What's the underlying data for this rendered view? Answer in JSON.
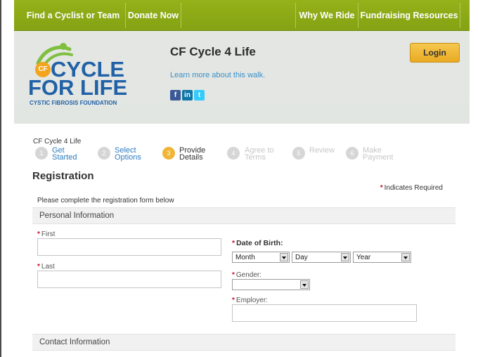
{
  "nav": {
    "left_items": [
      "Find a Cyclist or Team",
      "Donate Now"
    ],
    "right_items": [
      "Why We Ride",
      "Fundraising Resources"
    ]
  },
  "header": {
    "logo": {
      "badge": "CF",
      "line1": "CYCLE",
      "line2": "FOR LIFE",
      "sub": "CYSTIC FIBROSIS FOUNDATION"
    },
    "event_title": "CF Cycle 4 Life",
    "learn_more": "Learn more about this walk.",
    "social": [
      {
        "icon": "facebook-icon",
        "glyph": "f",
        "color": "#3b5998"
      },
      {
        "icon": "linkedin-icon",
        "glyph": "in",
        "color": "#0e76a8"
      },
      {
        "icon": "twitter-icon",
        "glyph": "t",
        "color": "#33ccff"
      }
    ],
    "login_label": "Login"
  },
  "breadcrumb": "CF Cycle 4 Life",
  "steps": [
    {
      "number": "1",
      "label1": "Get",
      "label2": "Started",
      "state": "done"
    },
    {
      "number": "2",
      "label1": "Select",
      "label2": "Options",
      "state": "done"
    },
    {
      "number": "3",
      "label1": "Provide",
      "label2": "Details",
      "state": "current"
    },
    {
      "number": "4",
      "label1": "Agree to",
      "label2": "Terms",
      "state": "upcoming"
    },
    {
      "number": "5",
      "label1": "Review",
      "label2": "",
      "state": "upcoming"
    },
    {
      "number": "6",
      "label1": "Make",
      "label2": "Payment",
      "state": "upcoming"
    }
  ],
  "form": {
    "title": "Registration",
    "required_note": "Indicates Required",
    "required_marker": "*",
    "instructions": "Please complete the registration form below",
    "sections": {
      "personal": "Personal Information",
      "contact": "Contact Information"
    },
    "fields": {
      "first": {
        "label": "First",
        "value": ""
      },
      "last": {
        "label": "Last",
        "value": ""
      },
      "dob": {
        "label": "Date of Birth:",
        "month": "Month",
        "day": "Day",
        "year": "Year"
      },
      "gender": {
        "label": "Gender:",
        "value": ""
      },
      "employer": {
        "label": "Employer:",
        "value": ""
      }
    }
  },
  "colors": {
    "nav_green": "#8fab16",
    "brand_blue": "#2161a7",
    "link_blue": "#3a8fc9",
    "login_gold": "#eeb22f",
    "required_red": "#c8102e"
  }
}
